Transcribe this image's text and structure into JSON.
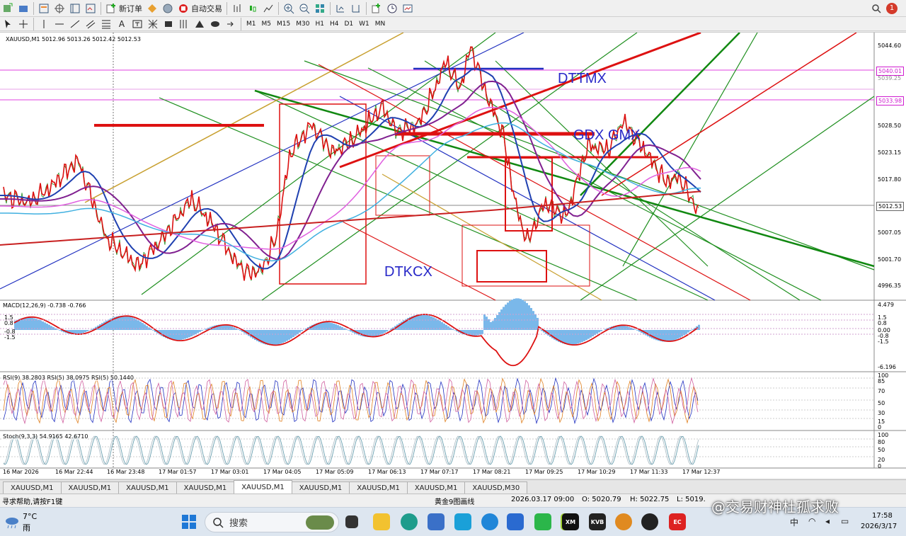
{
  "toolbar": {
    "new_order_label": "新订单",
    "auto_trade_label": "自动交易",
    "timeframes": [
      "M1",
      "M5",
      "M15",
      "M30",
      "H1",
      "H4",
      "D1",
      "W1",
      "MN"
    ],
    "notification_count": "1"
  },
  "chart": {
    "symbol_header": "XAUUSD,M1  5012.96 5013.26 5012.42 5012.53",
    "price_labels": [
      "5044.60",
      "5028.50",
      "5023.15",
      "5017.80",
      "5007.05",
      "5001.70",
      "4996.35"
    ],
    "price_tag_1": "5040.01",
    "price_tag_2": "5033.98",
    "price_tag_current": "5012.53",
    "price_tag_hidden": "5039.25",
    "annotation_dttmx": "DTTMX",
    "annotation_gdx": "GDX GMX",
    "annotation_dtkcx": "DTKCX",
    "time_labels": [
      "16 Mar 2026",
      "16 Mar 22:44",
      "16 Mar 23:48",
      "17 Mar 01:57",
      "17 Mar 03:01",
      "17 Mar 04:05",
      "17 Mar 05:09",
      "17 Mar 06:13",
      "17 Mar 07:17",
      "17 Mar 08:21",
      "17 Mar 09:25",
      "17 Mar 10:29",
      "17 Mar 11:33",
      "17 Mar 12:37"
    ]
  },
  "macd": {
    "label": "MACD(12,26,9) -0.738 -0.766",
    "left_levels": [
      "1.5",
      "0.8",
      "-0.8",
      "-1.5"
    ],
    "right_levels": [
      "4.479",
      "1.5",
      "0.8",
      "0.00",
      "-0.8",
      "-1.5",
      "-6.196"
    ]
  },
  "rsi": {
    "label": "RSI(9) 38.2803  RSI(5) 38.0975  RSI(5) 50.1440",
    "levels": [
      "100",
      "85",
      "70",
      "50",
      "30",
      "15",
      "0"
    ]
  },
  "stoch": {
    "label": "Stoch(9,3,3) 54.9165 42.6710",
    "levels": [
      "100",
      "80",
      "50",
      "20",
      "0"
    ]
  },
  "tabs": [
    "XAUUSD,M1",
    "XAUUSD,M1",
    "XAUUSD,M1",
    "XAUUSD,M1",
    "XAUUSD,M1",
    "XAUUSD,M1",
    "XAUUSD,M1",
    "XAUUSD,M1",
    "XAUUSD,M30"
  ],
  "status": {
    "help": "寻求帮助,请按F1键",
    "profile": "黄金9图画线",
    "datetime": "2026.03.17 09:00",
    "open": "O: 5020.79",
    "high": "H: 5022.75",
    "low": "L: 5019."
  },
  "taskbar": {
    "weather_temp": "7°C",
    "weather_desc": "雨",
    "search_placeholder": "搜索",
    "tray_lang": "中",
    "clock_time": "17:58",
    "clock_date": "2026/3/17"
  },
  "watermark": "@交易财神杜孤求败",
  "colors": {
    "accent_blue": "#2828c8",
    "line_red": "#dd1111",
    "line_green": "#118811",
    "macd_hist": "#7ab8ea"
  }
}
